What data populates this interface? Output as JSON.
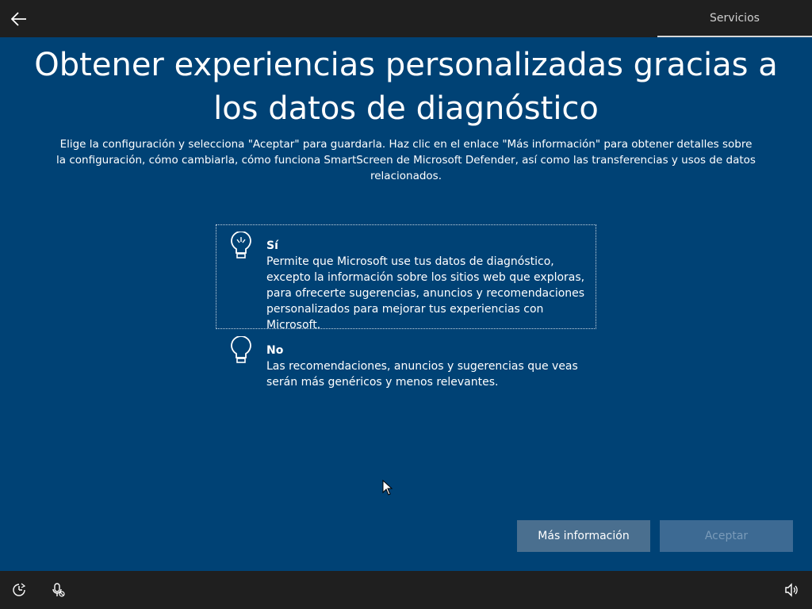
{
  "header": {
    "back_icon": "back-arrow-icon",
    "section_label": "Servicios"
  },
  "main": {
    "title": "Obtener experiencias personalizadas gracias a los datos de diagnóstico",
    "subtitle": "Elige la configuración y selecciona \"Aceptar\" para guardarla. Haz clic en el enlace \"Más información\" para obtener detalles sobre la configuración, cómo cambiarla, cómo funciona SmartScreen de Microsoft Defender, así como las transferencias y usos de datos relacionados."
  },
  "options": [
    {
      "icon": "lightbulb-on-icon",
      "title": "Sí",
      "description": "Permite que Microsoft use tus datos de diagnóstico, excepto la información sobre los sitios web que exploras, para ofrecerte sugerencias, anuncios y recomendaciones personalizados para mejorar tus experiencias con Microsoft.",
      "selected": true
    },
    {
      "icon": "lightbulb-off-icon",
      "title": "No",
      "description": "Las recomendaciones, anuncios y sugerencias que veas serán más genéricos y menos relevantes.",
      "selected": false
    }
  ],
  "buttons": {
    "more_info": "Más información",
    "accept": "Aceptar",
    "accept_enabled": false
  },
  "footer": {
    "icons": [
      "ease-of-access-icon",
      "microphone-off-icon",
      "volume-icon"
    ]
  },
  "colors": {
    "background": "#004275",
    "bar": "#1f1f1f",
    "button": "#4a6f8f",
    "button_disabled": "#3d6a93"
  }
}
